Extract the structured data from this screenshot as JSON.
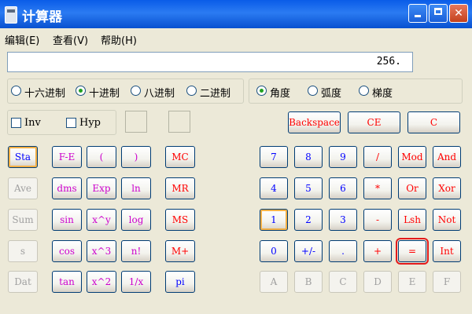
{
  "window": {
    "title": "计算器",
    "minimize": "_",
    "maximize": "□",
    "close": "✕"
  },
  "menu": [
    "编辑(E)",
    "查看(V)",
    "帮助(H)"
  ],
  "display": {
    "value": "256."
  },
  "base_modes": [
    {
      "label": "十六进制",
      "selected": false
    },
    {
      "label": "十进制",
      "selected": true
    },
    {
      "label": "八进制",
      "selected": false
    },
    {
      "label": "二进制",
      "selected": false
    }
  ],
  "angle_modes": [
    {
      "label": "角度",
      "selected": true
    },
    {
      "label": "弧度",
      "selected": false
    },
    {
      "label": "梯度",
      "selected": false
    }
  ],
  "checks": [
    {
      "label": "Inv"
    },
    {
      "label": "Hyp"
    }
  ],
  "edit_buttons": {
    "backspace": "Backspace",
    "ce": "CE",
    "c": "C"
  },
  "stat_buttons": [
    "Sta",
    "Ave",
    "Sum",
    "s",
    "Dat"
  ],
  "sci_col1": [
    "F-E",
    "dms",
    "sin",
    "cos",
    "tan"
  ],
  "sci_col2": [
    "(",
    "Exp",
    "x^y",
    "x^3",
    "x^2"
  ],
  "sci_col3": [
    ")",
    "ln",
    "log",
    "n!",
    "1/x"
  ],
  "memory_buttons": [
    "MC",
    "MR",
    "MS",
    "M+",
    "pi"
  ],
  "keypad": [
    [
      "7",
      "8",
      "9",
      "/",
      "Mod",
      "And"
    ],
    [
      "4",
      "5",
      "6",
      "*",
      "Or",
      "Xor"
    ],
    [
      "1",
      "2",
      "3",
      "-",
      "Lsh",
      "Not"
    ],
    [
      "0",
      "+/-",
      ".",
      "+",
      "=",
      "Int"
    ],
    [
      "A",
      "B",
      "C",
      "D",
      "E",
      "F"
    ]
  ],
  "colors": {
    "digit": "#0000ff",
    "operator": "#ff0000",
    "function": "#cc00cc",
    "disabled": "#a0a0a0"
  }
}
